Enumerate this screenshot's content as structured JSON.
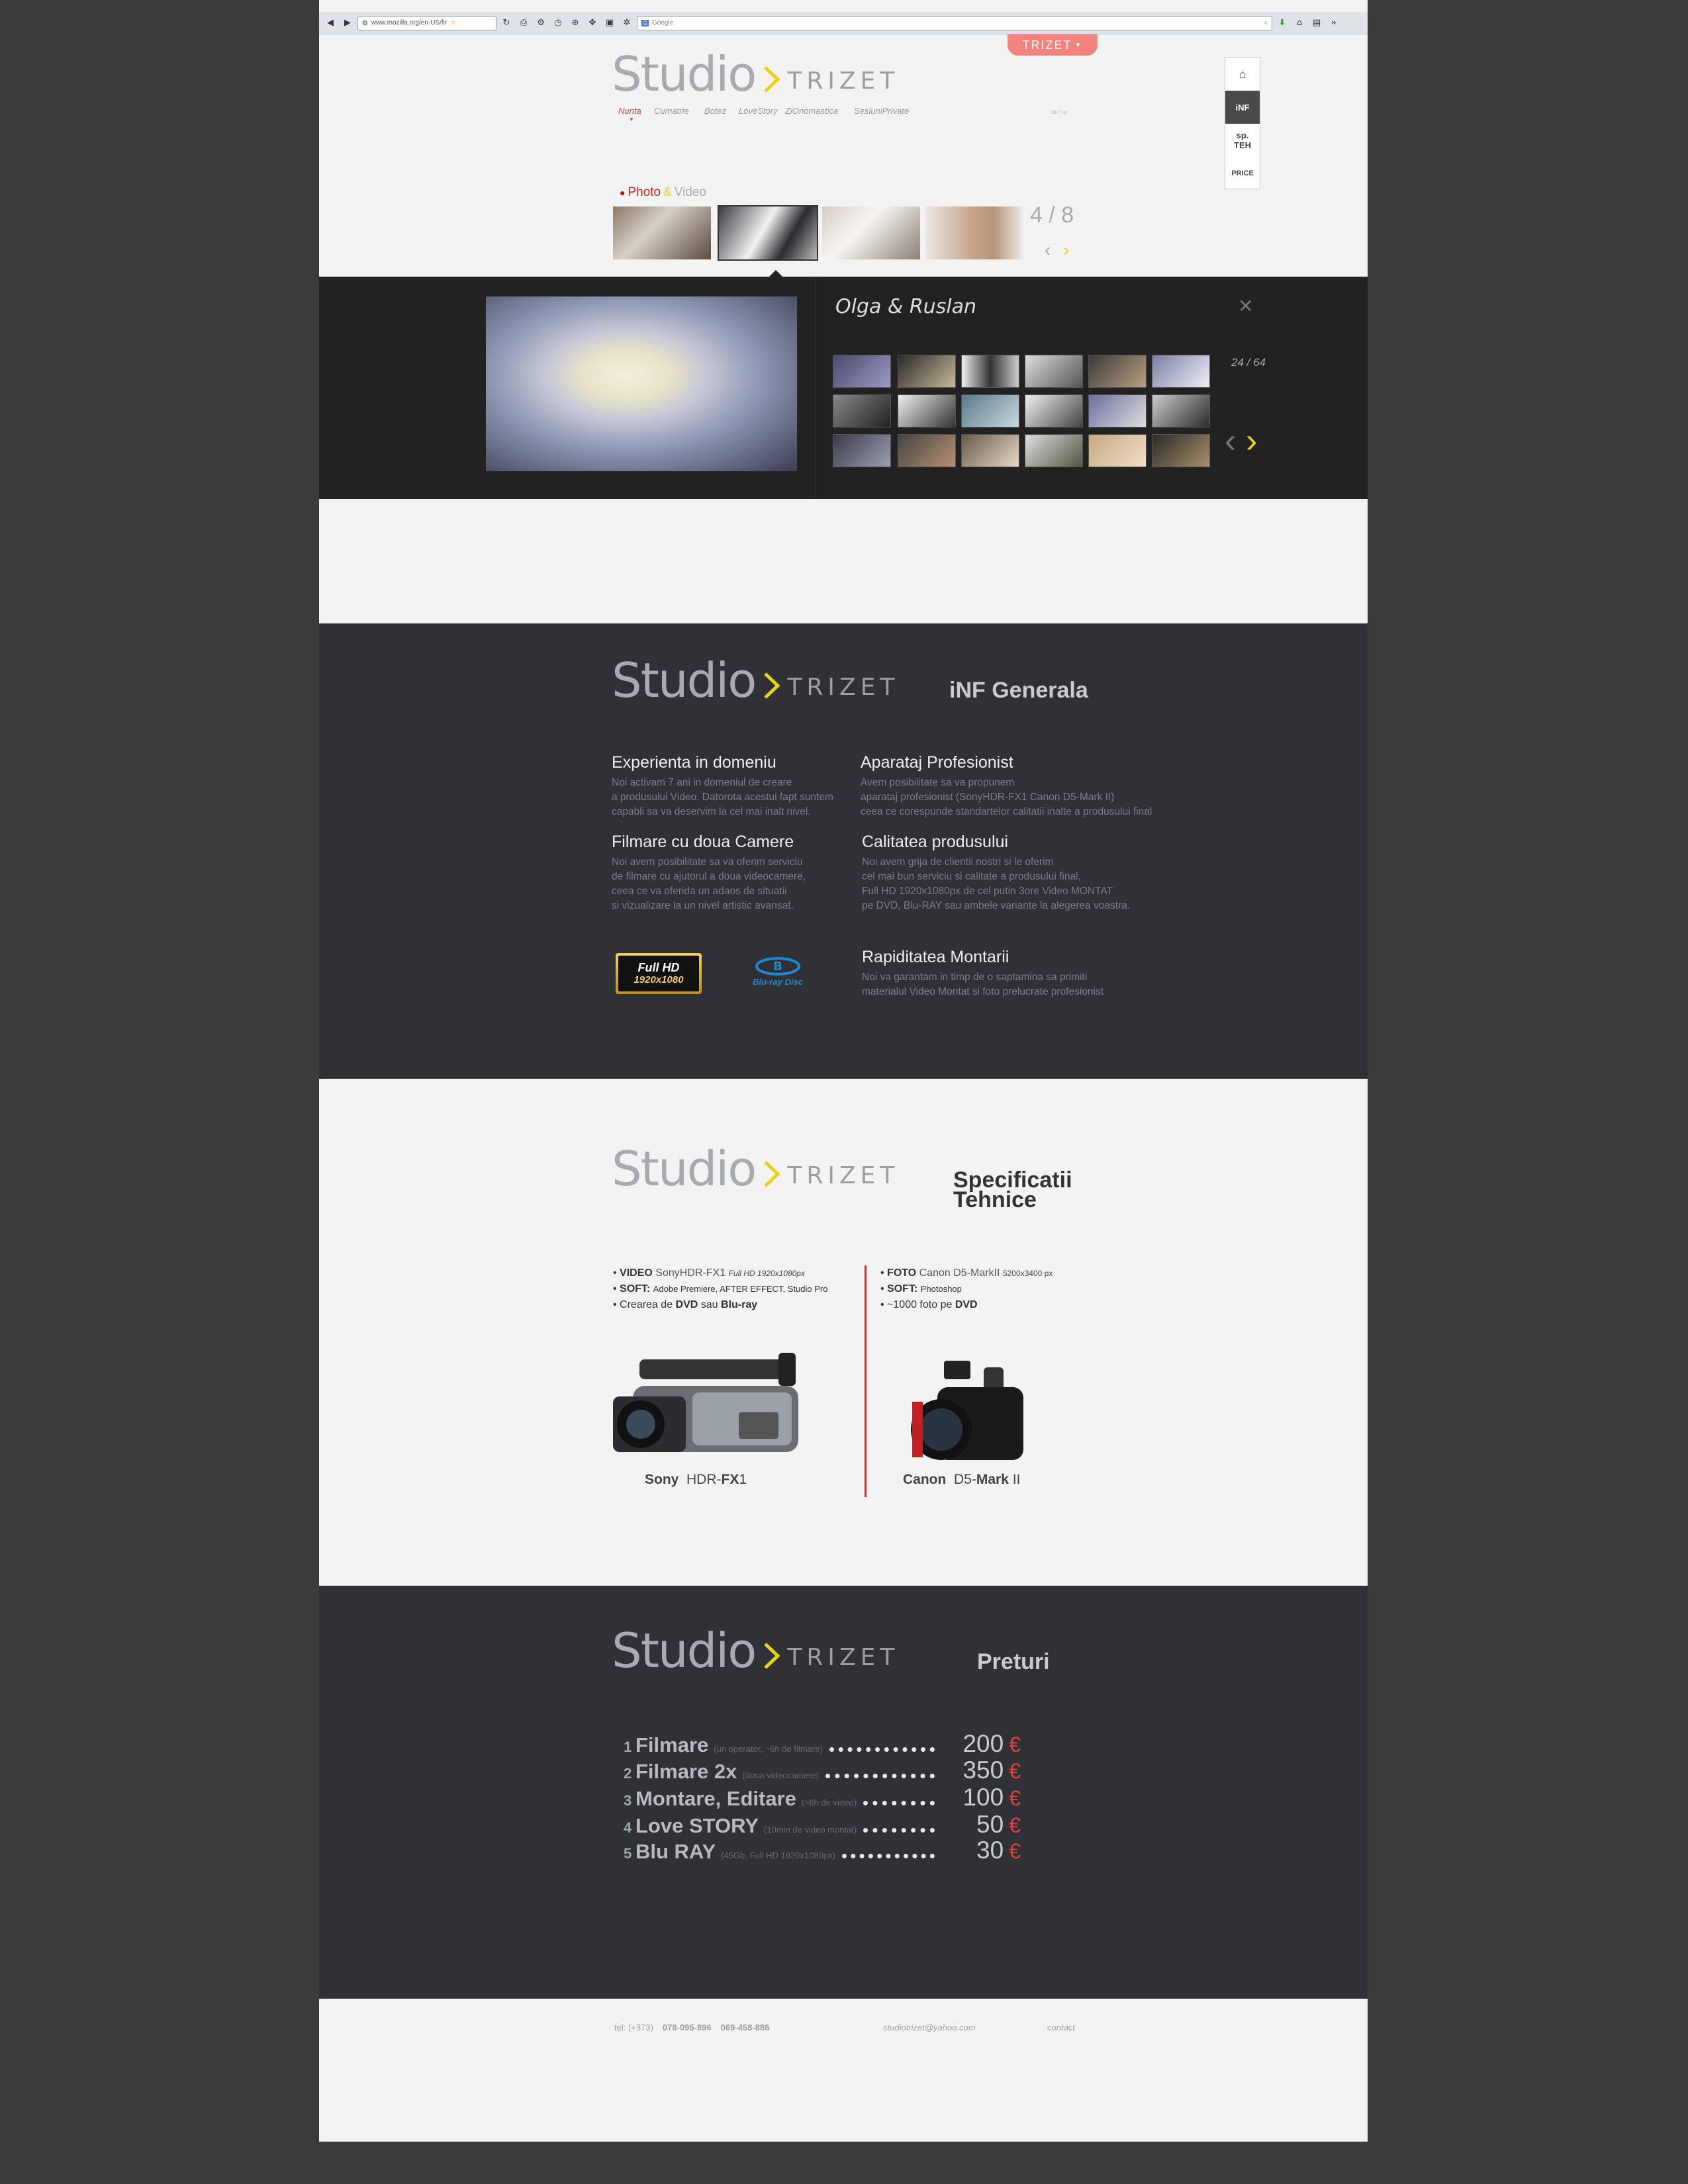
{
  "browser": {
    "url": "www.mozilla.org/en-US/fir",
    "search_engine_label": "Google"
  },
  "header": {
    "lang_tab": "TRIZET",
    "logo": {
      "studio": "Studio",
      "trizet": "TRIZET"
    },
    "nav": [
      "Nunta",
      "Cumatrie",
      "Botez",
      "LoveStory",
      "ZiOnomastica",
      "SesiuniPrivate"
    ],
    "tiny_text": "ro / ru",
    "side_menu": [
      "iNF",
      "sp.\nTEH",
      "PRICE"
    ],
    "media_tabs": {
      "photo": "Photo",
      "separator": "&",
      "video": "Video"
    },
    "counter": "4 / 8"
  },
  "gallery": {
    "title": "Olga & Ruslan",
    "counter": "24 / 64"
  },
  "info": {
    "section_title": "iNF Generala",
    "blocks": [
      {
        "title": "Experienta in domeniu",
        "lines": [
          "Noi activam 7 ani in domeniul de creare",
          "a produsului Video. Datorota acestui fapt suntem",
          "capabli sa va deservim la cel mai inalt nivel."
        ]
      },
      {
        "title": "Aparataj Profesionist",
        "lines": [
          "Avem posibilitate sa va propunem",
          "aparataj profesionist (SonyHDR-FX1 Canon  D5-Mark II)",
          "ceea ce corespunde standartelor calitatii inalte a produsului final"
        ]
      },
      {
        "title": "Filmare cu doua Camere",
        "lines": [
          "Noi avem posibilitate sa va oferim serviciu",
          "de filmare cu ajutorul a doua videocamere,",
          "ceea ce va oferida un adaos de situatii",
          "si vizualizare la un nivel artistic avansat."
        ]
      },
      {
        "title": "Calitatea produsului",
        "lines": [
          "Noi avem grija de clientii nostri si le oferim",
          "cel mai bun serviciu si calitate a produsului final,",
          "Full HD 1920x1080px de cel putin 3ore Video MONTAT",
          "pe DVD, Blu-RAY sau ambele variante la alegerea voastra."
        ]
      },
      {
        "title": "Rapiditatea Montarii",
        "lines": [
          "Noi va garantam in timp de o saptamina sa primiti",
          "materialul Video Montat si foto prelucrate profesionist"
        ]
      }
    ],
    "badge_fullhd": {
      "top": "Full HD",
      "bottom": "1920x1080"
    },
    "badge_bluray": "Blu-ray Disc"
  },
  "specs": {
    "section_title": [
      "Specificatii",
      "Tehnice"
    ],
    "video": [
      {
        "bold": "VIDEO",
        "text": "SonyHDR-FX1",
        "extra": "Full HD  1920x1080px"
      },
      {
        "bold": "SOFT:",
        "text": "Adobe Premiere, AFTER EFFECT,  Studio Pro"
      },
      {
        "pre": "Crearea de",
        "bold": "DVD",
        "mid": "sau",
        "bold2": "Blu-ray"
      }
    ],
    "photo": [
      {
        "bold": "FOTO",
        "text": "Canon D5-MarkII",
        "extra": "5200x3400 px"
      },
      {
        "bold": "SOFT:",
        "text": "Photoshop"
      },
      {
        "pre": "~1000 foto pe",
        "bold": "DVD"
      }
    ],
    "cam1": {
      "brand": "Sony",
      "model_pre": "HDR-",
      "model_bold": "FX",
      "model_post": "1"
    },
    "cam2": {
      "brand": "Canon",
      "model_pre": "D5-",
      "model_bold": "Mark",
      "model_post": " II"
    }
  },
  "prices": {
    "section_title": "Preturi",
    "currency": "€",
    "rows": [
      {
        "n": "1",
        "title": "Filmare",
        "desc": "(un operator,  ~6h de filmare)",
        "value": "200"
      },
      {
        "n": "2",
        "title": "Filmare 2x",
        "desc": "(doua videocamere)",
        "value": "350"
      },
      {
        "n": "3",
        "title": "Montare, Editare",
        "desc": "(≈6h de video)",
        "value": "100"
      },
      {
        "n": "4",
        "title": "Love STORY",
        "desc": "(10min  de video montat)",
        "value": "50"
      },
      {
        "n": "5",
        "title": "Blu RAY",
        "desc": "(45Gb,  Full HD 1920x1080px)",
        "value": "30"
      }
    ]
  },
  "footer": {
    "phone_prefix": "tel: (+373)",
    "phone1": "078-095-896",
    "phone2": "069-458-886",
    "email": "studiotrizet@yahoo.com",
    "contact": "contact"
  },
  "colors": {
    "accent_yellow": "#e8d21a",
    "accent_red": "#e04040",
    "tab_pink": "#f2837e"
  }
}
